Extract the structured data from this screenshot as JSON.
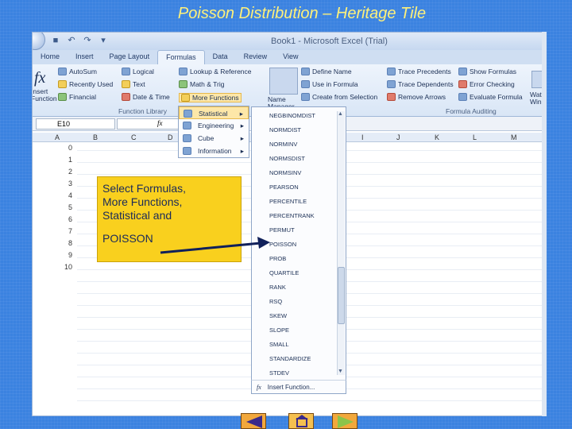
{
  "slide": {
    "title": "Poisson Distribution – Heritage Tile"
  },
  "window": {
    "title": "Book1 - Microsoft Excel (Trial)"
  },
  "ribbon_tabs": [
    "Home",
    "Insert",
    "Page Layout",
    "Formulas",
    "Data",
    "Review",
    "View"
  ],
  "ribbon": {
    "insert_function": "Insert Function",
    "autosum": "AutoSum",
    "recently_used": "Recently Used",
    "financial": "Financial",
    "logical": "Logical",
    "text": "Text",
    "date_time": "Date & Time",
    "lookup_reference": "Lookup & Reference",
    "math_trig": "Math & Trig",
    "more_functions": "More Functions",
    "function_library": "Function Library",
    "name_manager": "Name Manager",
    "define_name": "Define Name",
    "use_in_formula": "Use in Formula",
    "create_from_selection": "Create from Selection",
    "trace_precedents": "Trace Precedents",
    "trace_dependents": "Trace Dependents",
    "remove_arrows": "Remove Arrows",
    "show_formulas": "Show Formulas",
    "error_checking": "Error Checking",
    "evaluate_formula": "Evaluate Formula",
    "formula_auditing": "Formula Auditing",
    "watch_window": "Watc Wind"
  },
  "name_box": "E10",
  "fx_symbol": "fx",
  "columns": [
    "A",
    "B",
    "C",
    "D",
    "I",
    "J",
    "K",
    "L",
    "M"
  ],
  "rows": [
    "0",
    "1",
    "2",
    "3",
    "4",
    "5",
    "6",
    "7",
    "8",
    "9",
    "10"
  ],
  "more_functions_menu": [
    "Statistical",
    "Engineering",
    "Cube",
    "Information"
  ],
  "statistical_menu": [
    "NEGBINOMDIST",
    "NORMDIST",
    "NORMINV",
    "NORMSDIST",
    "NORMSINV",
    "PEARSON",
    "PERCENTILE",
    "PERCENTRANK",
    "PERMUT",
    "POISSON",
    "PROB",
    "QUARTILE",
    "RANK",
    "RSQ",
    "SKEW",
    "SLOPE",
    "SMALL",
    "STANDARDIZE",
    "STDEV"
  ],
  "insert_function_item": "Insert Function...",
  "callout": {
    "line1": "Select Formulas,",
    "line2": "More Functions,",
    "line3": "Statistical and",
    "line4": "POISSON"
  },
  "colors": {
    "slide_bg": "#3b82e0",
    "title": "#fff17a",
    "callout": "#f9d01e",
    "highlight": "#fde7a8"
  },
  "icons": [
    "office-button-icon",
    "save-icon",
    "undo-icon",
    "redo-icon",
    "fx-icon",
    "dropdown-arrow-icon",
    "submenu-arrow-icon"
  ]
}
